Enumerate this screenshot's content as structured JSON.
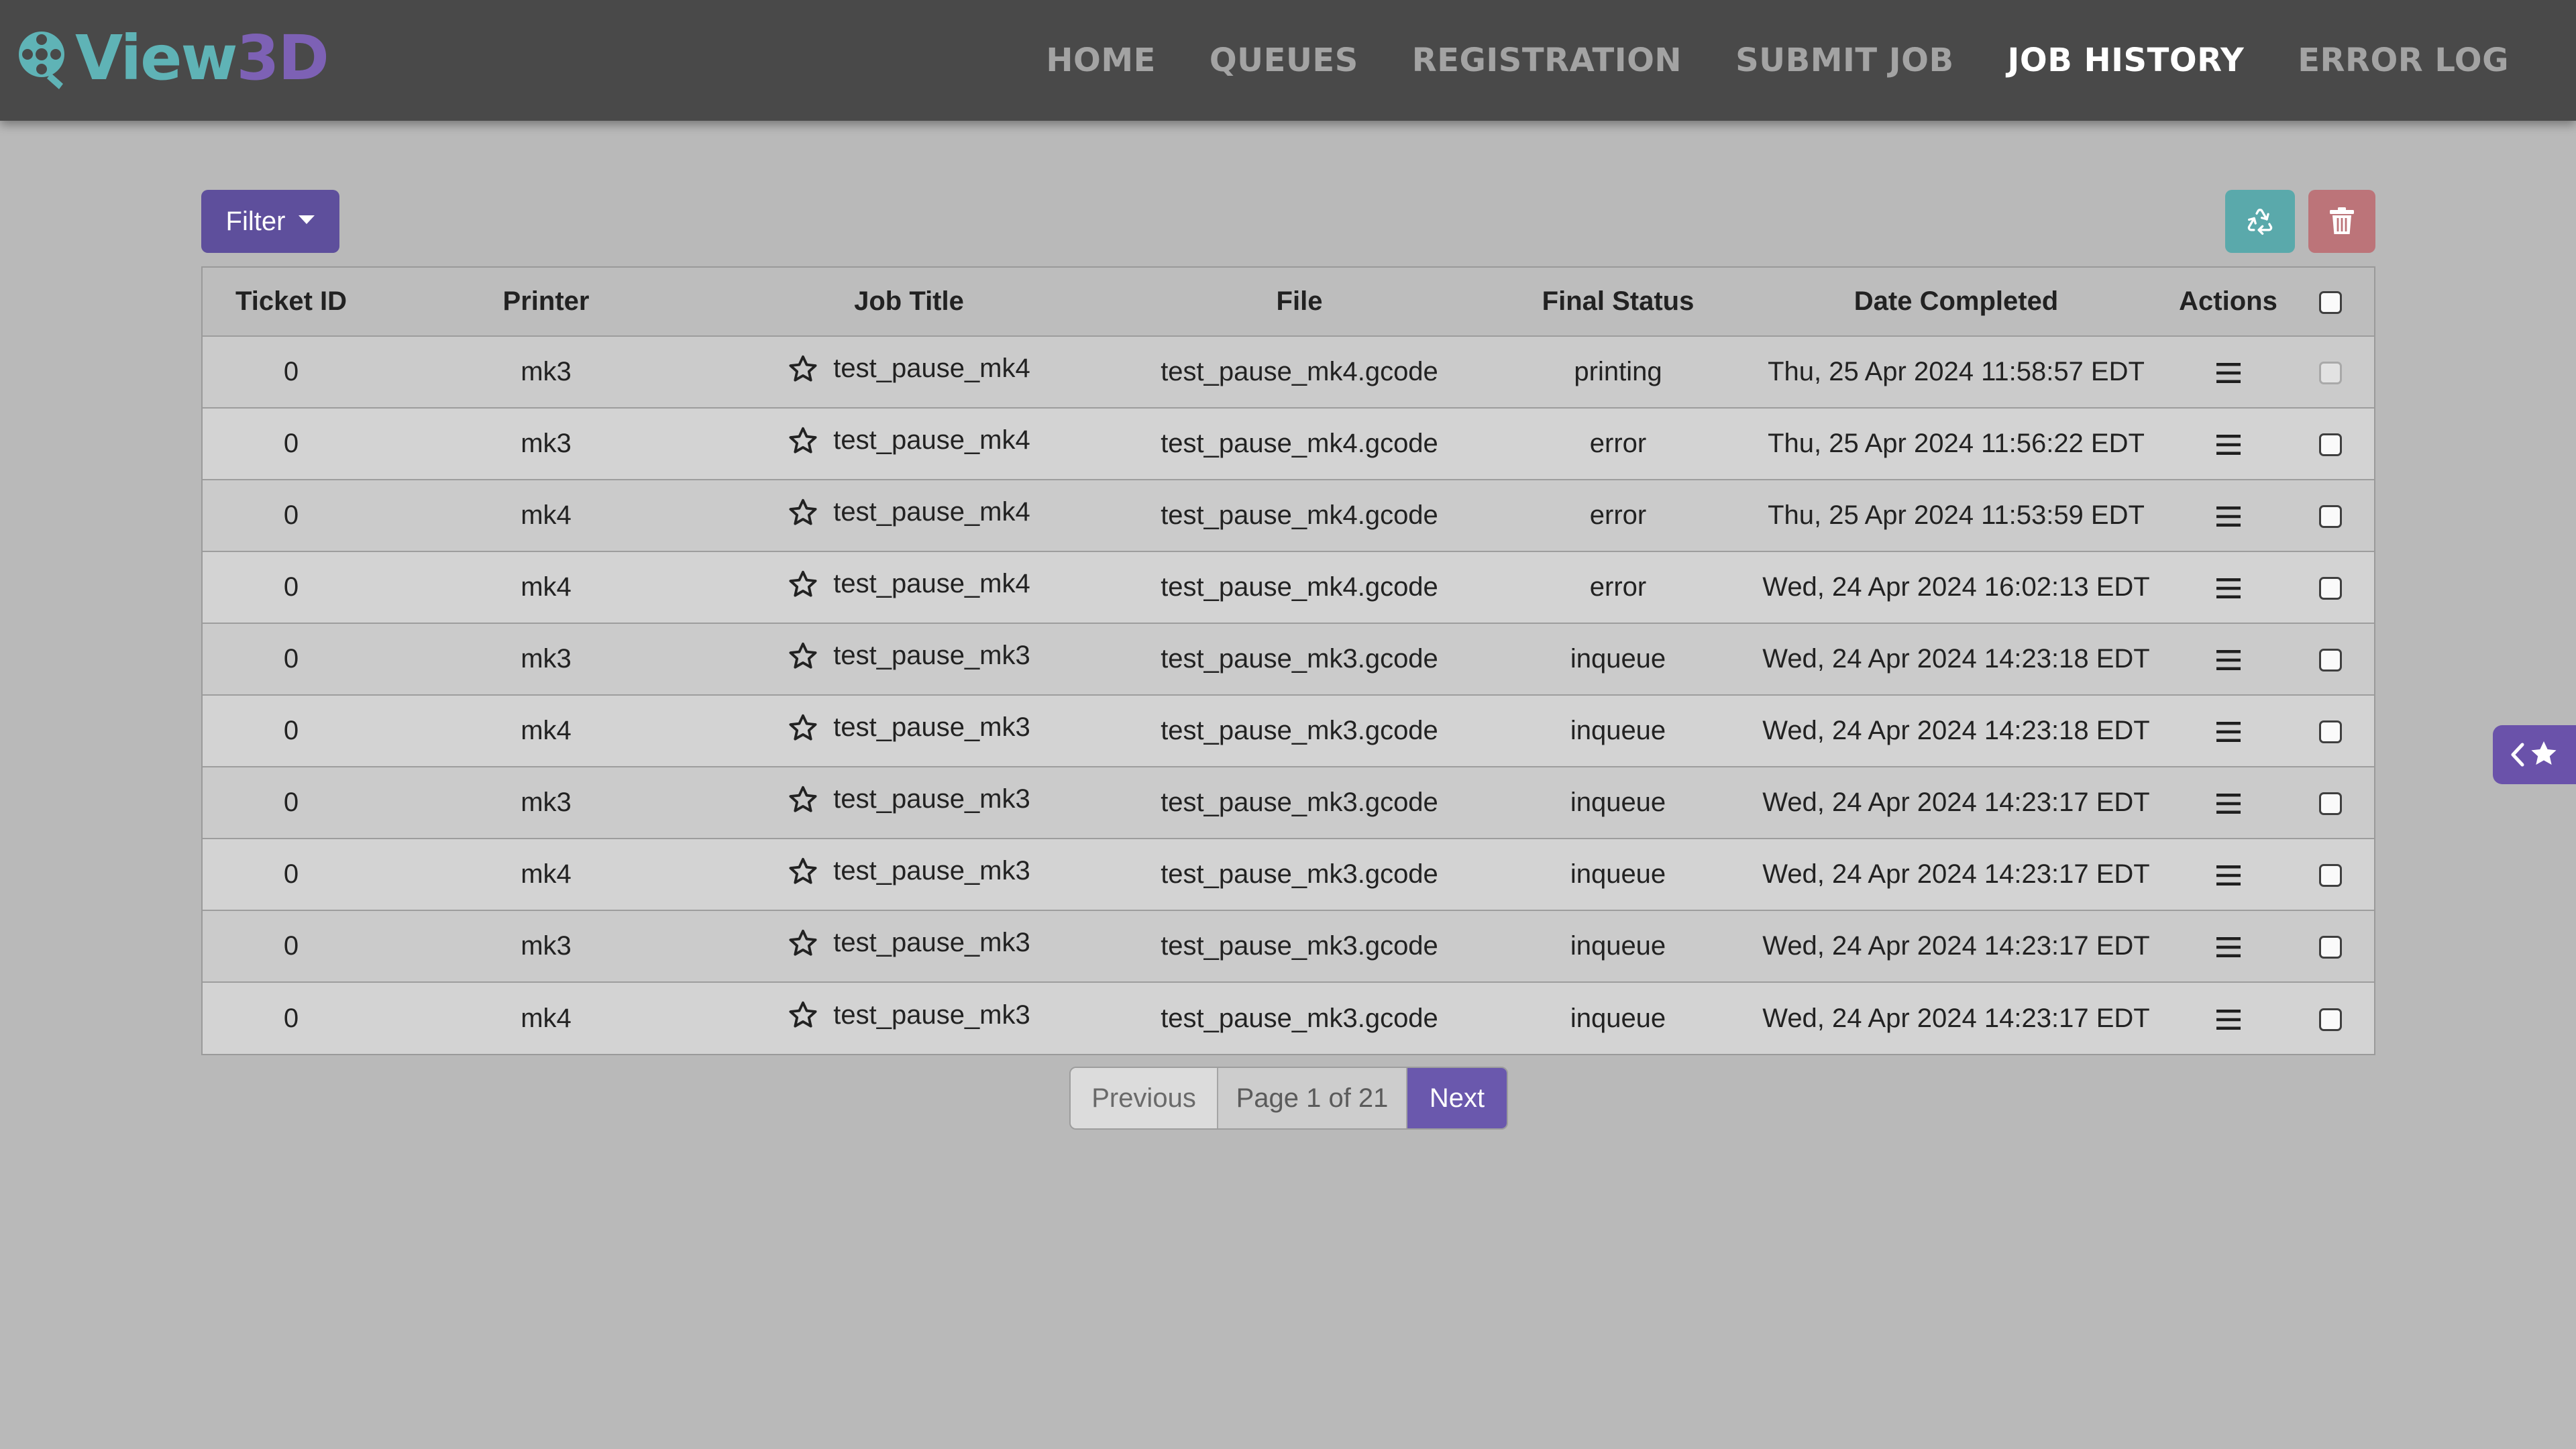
{
  "brand": {
    "name_part1": "View",
    "name_part2": "3D",
    "icon": "film-reel-magnifier-icon"
  },
  "nav": [
    {
      "label": "HOME",
      "active": false
    },
    {
      "label": "QUEUES",
      "active": false
    },
    {
      "label": "REGISTRATION",
      "active": false
    },
    {
      "label": "SUBMIT JOB",
      "active": false
    },
    {
      "label": "JOB HISTORY",
      "active": true
    },
    {
      "label": "ERROR LOG",
      "active": false
    }
  ],
  "toolbar": {
    "filter_label": "Filter",
    "recycle_icon": "recycle-icon",
    "trash_icon": "trash-icon"
  },
  "table": {
    "headers": [
      "Ticket ID",
      "Printer",
      "Job Title",
      "File",
      "Final Status",
      "Date Completed",
      "Actions"
    ],
    "rows": [
      {
        "ticket": "0",
        "printer": "mk3",
        "title": "test_pause_mk4",
        "file": "test_pause_mk4.gcode",
        "status": "printing",
        "date": "Thu, 25 Apr 2024 11:58:57 EDT"
      },
      {
        "ticket": "0",
        "printer": "mk3",
        "title": "test_pause_mk4",
        "file": "test_pause_mk4.gcode",
        "status": "error",
        "date": "Thu, 25 Apr 2024 11:56:22 EDT"
      },
      {
        "ticket": "0",
        "printer": "mk4",
        "title": "test_pause_mk4",
        "file": "test_pause_mk4.gcode",
        "status": "error",
        "date": "Thu, 25 Apr 2024 11:53:59 EDT"
      },
      {
        "ticket": "0",
        "printer": "mk4",
        "title": "test_pause_mk4",
        "file": "test_pause_mk4.gcode",
        "status": "error",
        "date": "Wed, 24 Apr 2024 16:02:13 EDT"
      },
      {
        "ticket": "0",
        "printer": "mk3",
        "title": "test_pause_mk3",
        "file": "test_pause_mk3.gcode",
        "status": "inqueue",
        "date": "Wed, 24 Apr 2024 14:23:18 EDT"
      },
      {
        "ticket": "0",
        "printer": "mk4",
        "title": "test_pause_mk3",
        "file": "test_pause_mk3.gcode",
        "status": "inqueue",
        "date": "Wed, 24 Apr 2024 14:23:18 EDT"
      },
      {
        "ticket": "0",
        "printer": "mk3",
        "title": "test_pause_mk3",
        "file": "test_pause_mk3.gcode",
        "status": "inqueue",
        "date": "Wed, 24 Apr 2024 14:23:17 EDT"
      },
      {
        "ticket": "0",
        "printer": "mk4",
        "title": "test_pause_mk3",
        "file": "test_pause_mk3.gcode",
        "status": "inqueue",
        "date": "Wed, 24 Apr 2024 14:23:17 EDT"
      },
      {
        "ticket": "0",
        "printer": "mk3",
        "title": "test_pause_mk3",
        "file": "test_pause_mk3.gcode",
        "status": "inqueue",
        "date": "Wed, 24 Apr 2024 14:23:17 EDT"
      },
      {
        "ticket": "0",
        "printer": "mk4",
        "title": "test_pause_mk3",
        "file": "test_pause_mk3.gcode",
        "status": "inqueue",
        "date": "Wed, 24 Apr 2024 14:23:17 EDT"
      }
    ]
  },
  "pagination": {
    "previous_label": "Previous",
    "info": "Page 1 of 21",
    "next_label": "Next"
  },
  "side_tab": {
    "icon": "favorites-toggle-icon"
  },
  "colors": {
    "navbar": "#494949",
    "background": "#b9b9b9",
    "brand_teal": "#5fb3b6",
    "brand_purple": "#7d61b5",
    "filter_button": "#5e4f9c",
    "recycle_button": "#5aa9ab",
    "trash_button": "#bc7479",
    "next_button": "#6a58ad"
  }
}
